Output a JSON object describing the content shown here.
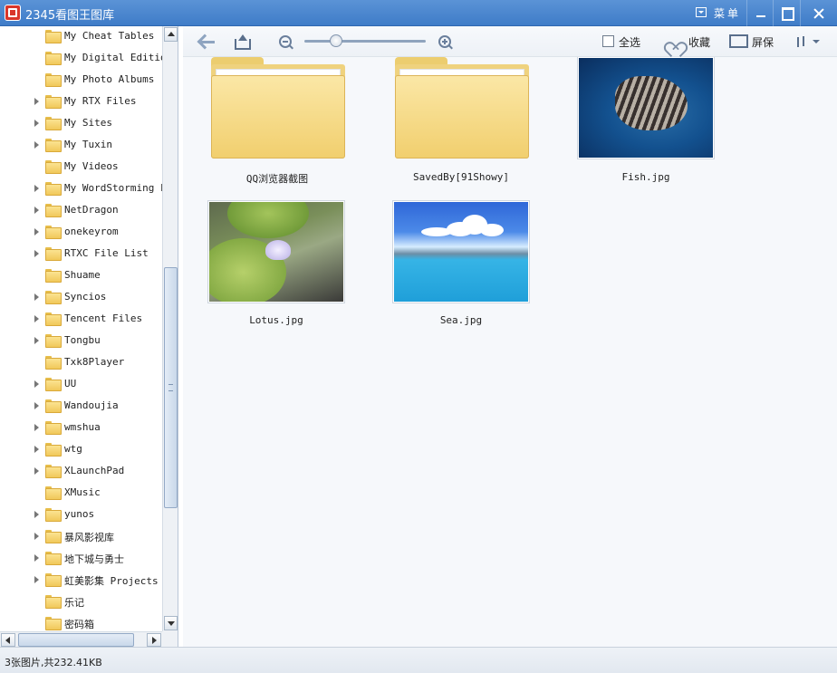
{
  "window": {
    "title": "2345看图王图库",
    "menu_label": "菜单"
  },
  "sidebar": {
    "items": [
      {
        "label": "My Cheat Tables",
        "expandable": false
      },
      {
        "label": "My Digital Editions",
        "expandable": false
      },
      {
        "label": "My Photo Albums",
        "expandable": false
      },
      {
        "label": "My RTX Files",
        "expandable": true
      },
      {
        "label": "My Sites",
        "expandable": true
      },
      {
        "label": "My Tuxin",
        "expandable": true
      },
      {
        "label": "My Videos",
        "expandable": false
      },
      {
        "label": "My WordStorming Files",
        "expandable": true
      },
      {
        "label": "NetDragon",
        "expandable": true
      },
      {
        "label": "onekeyrom",
        "expandable": true
      },
      {
        "label": "RTXC File List",
        "expandable": true
      },
      {
        "label": "Shuame",
        "expandable": false
      },
      {
        "label": "Syncios",
        "expandable": true
      },
      {
        "label": "Tencent Files",
        "expandable": true
      },
      {
        "label": "Tongbu",
        "expandable": true
      },
      {
        "label": "Txk8Player",
        "expandable": false
      },
      {
        "label": "UU",
        "expandable": true
      },
      {
        "label": "Wandoujia",
        "expandable": true
      },
      {
        "label": "wmshua",
        "expandable": true
      },
      {
        "label": "wtg",
        "expandable": true
      },
      {
        "label": "XLaunchPad",
        "expandable": true
      },
      {
        "label": "XMusic",
        "expandable": false
      },
      {
        "label": "yunos",
        "expandable": true
      },
      {
        "label": "暴风影视库",
        "expandable": true
      },
      {
        "label": "地下城与勇士",
        "expandable": true
      },
      {
        "label": "虹美影集 Projects",
        "expandable": true
      },
      {
        "label": "乐记",
        "expandable": false
      },
      {
        "label": "密码箱",
        "expandable": false
      }
    ]
  },
  "toolbar": {
    "select_all_label": "全选",
    "favorite_label": "收藏",
    "screensaver_label": "屏保",
    "zoom_level": 0.23
  },
  "content": {
    "items": [
      {
        "name": "QQ浏览器截图",
        "kind": "folder"
      },
      {
        "name": "SavedBy[91Showy]",
        "kind": "folder"
      },
      {
        "name": "Fish.jpg",
        "kind": "image"
      },
      {
        "name": "Lotus.jpg",
        "kind": "image"
      },
      {
        "name": "Sea.jpg",
        "kind": "image"
      }
    ]
  },
  "status": {
    "text": "3张图片,共232.41KB"
  }
}
